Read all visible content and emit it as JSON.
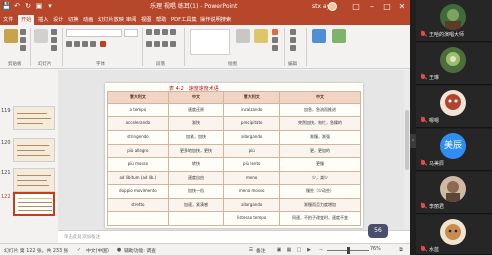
{
  "app": {
    "window_title": "乐理 视唱 练耳(1) - PowerPoint",
    "user_name": "stx ay",
    "quick_access": [
      "save-icon",
      "undo-icon",
      "redo-icon",
      "present-icon",
      "customize-icon"
    ],
    "window_controls": [
      "ribbon-display-icon",
      "minimize-icon",
      "maximize-icon",
      "close-icon"
    ]
  },
  "tabs": [
    {
      "label": "文件",
      "active": false
    },
    {
      "label": "开始",
      "active": true
    },
    {
      "label": "插入",
      "active": false
    },
    {
      "label": "设计",
      "active": false
    },
    {
      "label": "切换",
      "active": false
    },
    {
      "label": "动画",
      "active": false
    },
    {
      "label": "幻灯片放映",
      "active": false
    },
    {
      "label": "审阅",
      "active": false
    },
    {
      "label": "视图",
      "active": false
    },
    {
      "label": "帮助",
      "active": false
    },
    {
      "label": "PDF工具集",
      "active": false
    },
    {
      "label": "操作说明搜索",
      "active": false
    }
  ],
  "ribbon_groups": [
    "剪贴板",
    "幻灯片",
    "字体",
    "段落",
    "绘图",
    "编辑"
  ],
  "thumbnails": [
    {
      "num": "119",
      "selected": false
    },
    {
      "num": "120",
      "selected": false
    },
    {
      "num": "121",
      "selected": false
    },
    {
      "num": "122",
      "selected": true
    }
  ],
  "slide": {
    "caption": "表 4-2　速度速度术语",
    "headers": [
      "意大利文",
      "中文",
      "意大利文",
      "中文"
    ],
    "rows": [
      [
        "a tempo",
        "速度还原",
        "incalzando",
        "加急，急流而推进"
      ],
      [
        "accelerando",
        "渐快",
        "precipitato",
        "突然加快，匆忙，急躁的"
      ],
      [
        "stringendo",
        "加紧，加快",
        "allargando",
        "渐慢，渐强"
      ],
      [
        "più allegro",
        "更多地加快，更快",
        "più",
        "更，更加的"
      ],
      [
        "più mosso",
        "转快",
        "più lento",
        "更慢"
      ],
      [
        "ad libitum (ad lib.)",
        "速度自由",
        "meno",
        "少，减少"
      ],
      [
        "doppio movimento",
        "加快一倍",
        "meno mosso",
        "慢些（少动些）"
      ],
      [
        "stretto",
        "加速，紧凑感",
        "allargando",
        "渐慢而且力度增加"
      ],
      [
        "",
        "",
        "listesso tempo",
        "同速，不拍子改变时，速度不变"
      ]
    ]
  },
  "notes_placeholder": "单击此处添加备注",
  "status": {
    "slide_info": "幻灯片 第 122 张，共 233 张",
    "language": "中文(中国)",
    "accessibility": "辅助功能: 调查",
    "notes_label": "备注",
    "zoom": "76%",
    "zoom_fraction": 0.5
  },
  "overlay_label": "56",
  "participants": [
    {
      "name": "王哈的演唱大师",
      "avatar_text": "",
      "avatar_color": "#3f6b3a",
      "muted": true
    },
    {
      "name": "王琳",
      "avatar_text": "",
      "avatar_color": "#4e6d3d",
      "muted": true
    },
    {
      "name": "嗯嗯",
      "avatar_text": "",
      "avatar_color": "#b2442f",
      "muted": true
    },
    {
      "name": "马美辰",
      "avatar_text": "美辰",
      "avatar_color": "#2f8df5",
      "muted": true
    },
    {
      "name": "李丽君",
      "avatar_text": "",
      "avatar_color": "#8c6a52",
      "muted": true
    },
    {
      "name": "水蓝",
      "avatar_text": "",
      "avatar_color": "#c88d4e",
      "muted": true
    }
  ],
  "colors": {
    "accent": "#b7472a",
    "table_header": "#f1d4c4",
    "panel_bg": "#1f1f1f",
    "mute_red": "#e24b4b"
  }
}
